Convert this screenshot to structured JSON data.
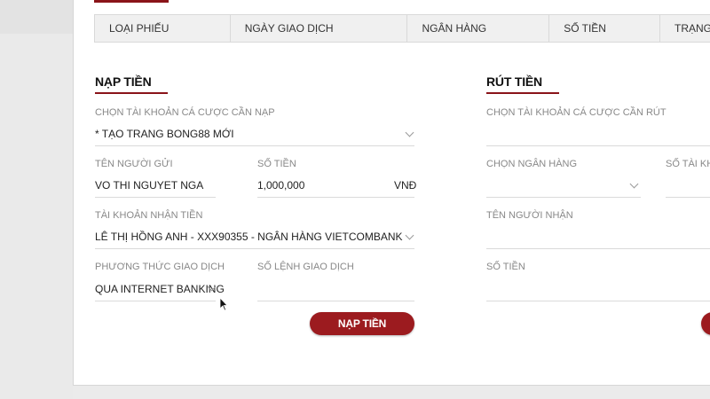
{
  "table": {
    "headers": [
      "LOẠI PHIẾU",
      "NGÀY GIAO DỊCH",
      "NGÂN HÀNG",
      "SỐ TIỀN",
      "TRẠNG T"
    ]
  },
  "deposit": {
    "title": "NẠP TIỀN",
    "account_label": "CHỌN TÀI KHOẢN CÁ CƯỢC CẦN NẠP",
    "account_value": "* TẠO TRANG BONG88 MỚI",
    "sender_label": "TÊN NGƯỜI GỬI",
    "sender_value": "VO THI NGUYET NGA",
    "amount_label": "SỐ TIỀN",
    "amount_value": "1,000,000",
    "currency": "VNĐ",
    "receiving_label": "TÀI KHOẢN NHẬN TIỀN",
    "receiving_value": "LÊ THỊ HỒNG ANH - XXX90355 - NGÂN HÀNG VIETCOMBANK",
    "method_label": "PHƯƠNG THỨC GIAO DỊCH",
    "method_value": "QUA INTERNET BANKING",
    "order_label": "SỐ LỆNH GIAO DỊCH",
    "order_value": "",
    "submit_label": "NẠP TIỀN"
  },
  "withdraw": {
    "title": "RÚT TIỀN",
    "account_label": "CHỌN TÀI KHOẢN CÁ CƯỢC CẦN RÚT",
    "bank_label": "CHỌN NGÂN HÀNG",
    "account_no_label": "SỐ TÀI KHO",
    "receiver_label": "TÊN NGƯỜI NHẬN",
    "amount_label": "SỐ TIỀN"
  },
  "colors": {
    "accent": "#9c1b1f",
    "underline": "#8a1419"
  },
  "icons": {
    "dropdown": "chevron-down-icon",
    "cursor": "mouse-pointer-icon"
  }
}
